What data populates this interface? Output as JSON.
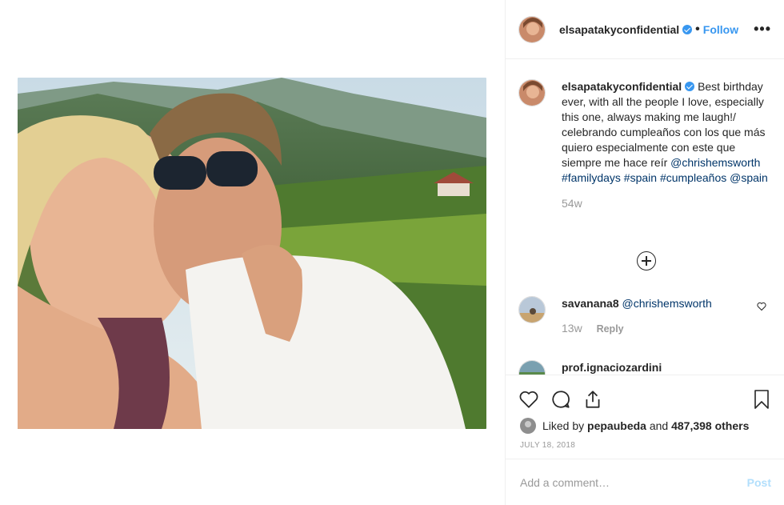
{
  "post": {
    "username": "elsapatakyconfidential",
    "follow_label": "Follow",
    "dot": "•",
    "more_label": "•••",
    "caption": {
      "username": "elsapatakyconfidential",
      "text_1": "Best birthday ever, with all the people I love, especially this one, always making me laugh!/ celebrando cumpleaños con los que más quiero especialmente con este que siempre me hace reír ",
      "mention": "@chrishemsworth",
      "tags": "#familydays #spain #cumpleaños",
      "mention_2": "@spain",
      "age": "54w"
    },
    "comments": [
      {
        "username": "savanana8",
        "text": "@chrishemsworth",
        "age": "13w",
        "reply_label": "Reply"
      },
      {
        "username": "prof.ignaciozardini",
        "text": ""
      }
    ],
    "likes": {
      "prefix": "Liked by",
      "user": "pepaubeda",
      "joiner": "and",
      "count": "487,398 others"
    },
    "date": "JULY 18, 2018",
    "add_comment": {
      "placeholder": "Add a comment…",
      "post_label": "Post"
    }
  },
  "colors": {
    "accent": "#3897f0",
    "post_disabled": "#b2dffc",
    "muted": "#999999"
  }
}
